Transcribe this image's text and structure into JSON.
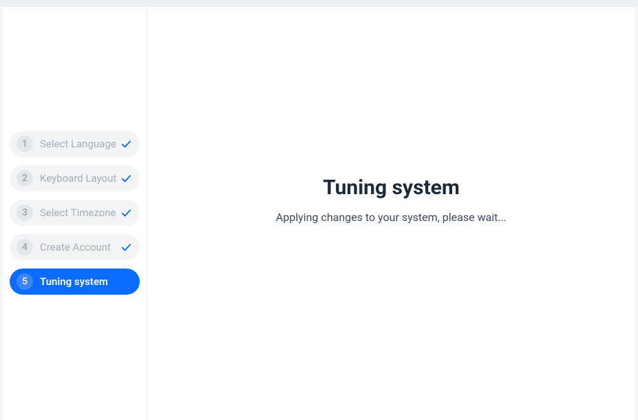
{
  "sidebar": {
    "steps": [
      {
        "number": "1",
        "label": "Select Language",
        "completed": true,
        "active": false
      },
      {
        "number": "2",
        "label": "Keyboard Layout",
        "completed": true,
        "active": false
      },
      {
        "number": "3",
        "label": "Select Timezone",
        "completed": true,
        "active": false
      },
      {
        "number": "4",
        "label": "Create Account",
        "completed": true,
        "active": false
      },
      {
        "number": "5",
        "label": "Tuning system",
        "completed": false,
        "active": true
      }
    ]
  },
  "main": {
    "title": "Tuning system",
    "message": "Applying changes to your system, please wait..."
  }
}
